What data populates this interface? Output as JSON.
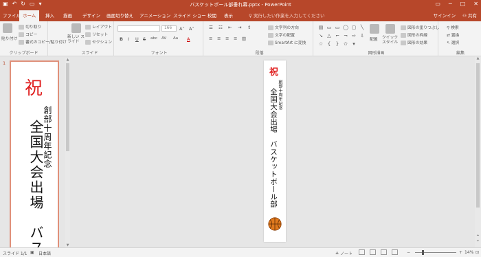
{
  "window": {
    "title": "バスケットボール部垂れ幕.pptx - PowerPoint"
  },
  "tabs": [
    "ファイル",
    "ホーム",
    "挿入",
    "描画",
    "デザイン",
    "画面切り替え",
    "アニメーション",
    "スライド ショー",
    "校閲",
    "表示"
  ],
  "tell_me": "実行したい作業を入力してください",
  "account": {
    "signin": "サインイン",
    "share": "共有"
  },
  "ribbon": {
    "clipboard": {
      "label": "クリップボード",
      "paste": "貼り付け",
      "cut": "切り取り",
      "copy": "コピー",
      "format_painter": "書式のコピー/貼り付け"
    },
    "slides": {
      "label": "スライド",
      "new_slide": "新しい スライド",
      "layout": "レイアウト",
      "reset": "リセット",
      "section": "セクション"
    },
    "font": {
      "label": "フォント",
      "size": "166",
      "bold": "B",
      "italic": "I",
      "underline": "U",
      "strike": "S",
      "shadow": "abc",
      "spacing": "AV",
      "case": "Aa",
      "color": "A"
    },
    "paragraph": {
      "label": "段落",
      "text_direction": "文字列の方向",
      "align_text": "文字の配置",
      "smartart": "SmartArt に変換"
    },
    "drawing": {
      "label": "図形描画",
      "arrange": "配置",
      "quick_styles": "クイック スタイル",
      "shape_fill": "図形の塗りつぶし",
      "shape_outline": "図形の枠線",
      "shape_effects": "図形の効果"
    },
    "editing": {
      "label": "編集",
      "find": "検索",
      "replace": "置換",
      "select": "選択"
    }
  },
  "slide": {
    "number": "1",
    "iwai": "祝",
    "line1": "創部十周年記念",
    "line2": "全国大会出場　バスケットボール部",
    "thumb_line2": "全国大会出場　バス"
  },
  "status": {
    "slide_count": "スライド 1/1",
    "language": "日本語",
    "notes": "ノート",
    "zoom": "14%"
  },
  "colors": {
    "accent": "#b7472a",
    "iwai_red": "#e02020",
    "ball": "#e07a1e"
  },
  "icons": [
    "undo-icon",
    "redo-icon",
    "save-icon",
    "basketball-icon",
    "search-icon",
    "user-icon"
  ]
}
